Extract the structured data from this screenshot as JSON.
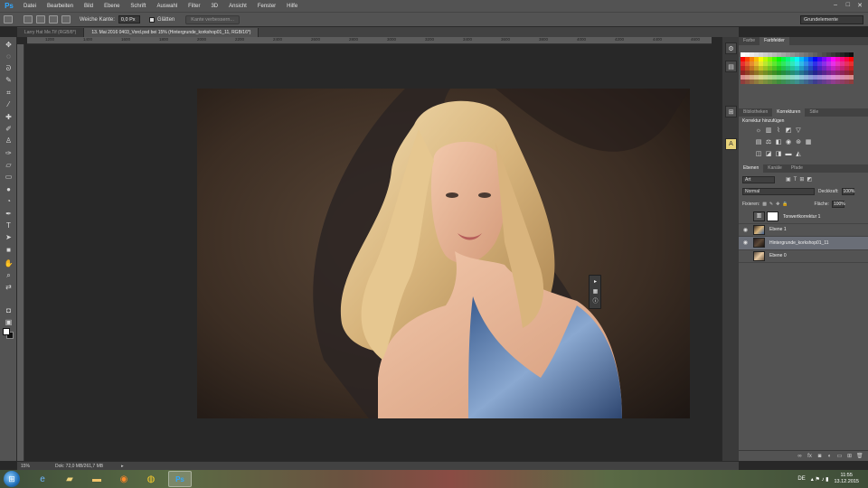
{
  "app": {
    "logo": "Ps"
  },
  "menu": [
    "Datei",
    "Bearbeiten",
    "Bild",
    "Ebene",
    "Schrift",
    "Auswahl",
    "Filter",
    "3D",
    "Ansicht",
    "Fenster",
    "Hilfe"
  ],
  "window_controls": [
    "–",
    "□",
    "✕"
  ],
  "options": {
    "edge_label": "Weiche Kante:",
    "edge_value": "0,0 Px",
    "smooth_label": "Glätten",
    "refine_button": "Kante verbessern...",
    "workspace": "Grundelemente"
  },
  "tabs": [
    {
      "label": "Larry Hat Me.Tif (RGB/8*)",
      "active": false
    },
    {
      "label": "13. Mai 2016 0403_Vord.psd bei 15% (Hintergrunde_korkshop01_11, RGB/16*)",
      "active": true
    }
  ],
  "ruler_marks": [
    "1200",
    "1400",
    "1600",
    "1800",
    "2000",
    "2200",
    "2400",
    "2600",
    "2800",
    "3000",
    "3200",
    "3400",
    "3600",
    "3800",
    "4000",
    "4200",
    "4400",
    "4600"
  ],
  "tools": [
    "move-tool",
    "marquee-tool",
    "lasso-tool",
    "quick-select-tool",
    "crop-tool",
    "eyedropper-tool",
    "healing-tool",
    "brush-tool",
    "clone-stamp-tool",
    "history-brush-tool",
    "eraser-tool",
    "gradient-tool",
    "blur-tool",
    "dodge-tool",
    "pen-tool",
    "type-tool",
    "path-select-tool",
    "rectangle-tool",
    "hand-tool",
    "zoom-tool"
  ],
  "status": {
    "zoom": "15%",
    "doc_info": "Dok: 72,0 MB/261,7 MB"
  },
  "panels": {
    "color_tabs": [
      {
        "label": "Farbe",
        "active": false
      },
      {
        "label": "Farbfelder",
        "active": true
      }
    ],
    "adjust_tabs": [
      {
        "label": "Bibliotheken",
        "active": false
      },
      {
        "label": "Korrekturen",
        "active": true
      },
      {
        "label": "Stile",
        "active": false
      }
    ],
    "adjust_title": "Korrektur hinzufügen",
    "layer_tabs": [
      {
        "label": "Ebenen",
        "active": true
      },
      {
        "label": "Kanäle",
        "active": false
      },
      {
        "label": "Pfade",
        "active": false
      }
    ],
    "filter_kind": "Art",
    "blend_mode": "Normal",
    "opacity_label": "Deckkraft:",
    "opacity": "100%",
    "lock_label": "Fixieren:",
    "fill_label": "Fläche:",
    "fill": "100%",
    "layers": [
      {
        "name": "Tonwertkorrektur 1",
        "visible": false,
        "selected": false,
        "type": "adjustment"
      },
      {
        "name": "Ebene 1",
        "visible": true,
        "selected": false,
        "type": "portrait"
      },
      {
        "name": "Hintergrunde_korkshop01_11",
        "visible": true,
        "selected": true,
        "type": "texture"
      },
      {
        "name": "Ebene 0",
        "visible": false,
        "selected": false,
        "type": "portrait-small"
      }
    ]
  },
  "taskbar": {
    "apps": [
      "internet-explorer",
      "file-explorer",
      "folder",
      "firefox",
      "chrome",
      "photoshop"
    ],
    "locale": "DE",
    "time": "11:55",
    "date": "13.12.2015"
  }
}
